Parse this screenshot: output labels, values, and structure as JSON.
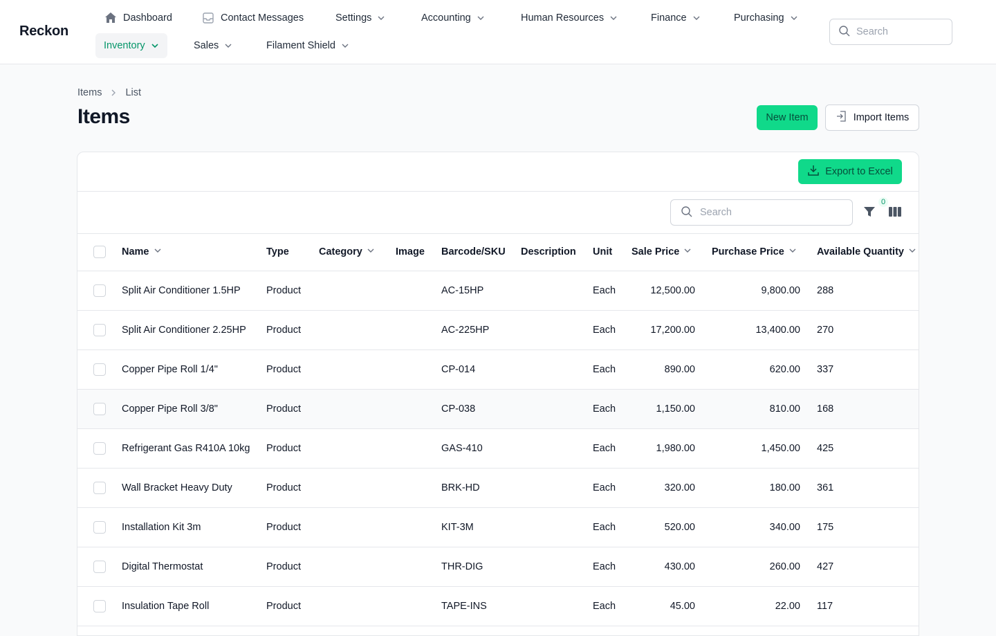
{
  "brand": "Reckon",
  "nav": {
    "row1": [
      {
        "label": "Dashboard",
        "icon": "home-icon",
        "chevron": false
      },
      {
        "label": "Contact Messages",
        "icon": "inbox-icon",
        "chevron": false
      },
      {
        "label": "Settings",
        "chevron": true
      },
      {
        "label": "Accounting",
        "chevron": true
      },
      {
        "label": "Human Resources",
        "chevron": true
      },
      {
        "label": "Finance",
        "chevron": true
      },
      {
        "label": "Purchasing",
        "chevron": true
      }
    ],
    "row2": [
      {
        "label": "Inventory",
        "chevron": true,
        "active": true
      },
      {
        "label": "Sales",
        "chevron": true
      },
      {
        "label": "Filament Shield",
        "chevron": true
      }
    ],
    "search_placeholder": "Search"
  },
  "breadcrumb": [
    "Items",
    "List"
  ],
  "page_title": "Items",
  "actions": {
    "new_item": "New Item",
    "import_items": "Import Items",
    "export": "Export to Excel"
  },
  "table": {
    "search_placeholder": "Search",
    "filter_count": "0",
    "columns": [
      "Name",
      "Type",
      "Category",
      "Image",
      "Barcode/SKU",
      "Description",
      "Unit",
      "Sale Price",
      "Purchase Price",
      "Available Quantity"
    ],
    "rows": [
      {
        "name": "Split Air Conditioner 1.5HP",
        "type": "Product",
        "category": "",
        "sku": "AC-15HP",
        "description": "",
        "unit": "Each",
        "sale": "12,500.00",
        "purchase": "9,800.00",
        "qty": "288"
      },
      {
        "name": "Split Air Conditioner 2.25HP",
        "type": "Product",
        "category": "",
        "sku": "AC-225HP",
        "description": "",
        "unit": "Each",
        "sale": "17,200.00",
        "purchase": "13,400.00",
        "qty": "270"
      },
      {
        "name": "Copper Pipe Roll 1/4\"",
        "type": "Product",
        "category": "",
        "sku": "CP-014",
        "description": "",
        "unit": "Each",
        "sale": "890.00",
        "purchase": "620.00",
        "qty": "337"
      },
      {
        "name": "Copper Pipe Roll 3/8\"",
        "type": "Product",
        "category": "",
        "sku": "CP-038",
        "description": "",
        "unit": "Each",
        "sale": "1,150.00",
        "purchase": "810.00",
        "qty": "168"
      },
      {
        "name": "Refrigerant Gas R410A 10kg",
        "type": "Product",
        "category": "",
        "sku": "GAS-410",
        "description": "",
        "unit": "Each",
        "sale": "1,980.00",
        "purchase": "1,450.00",
        "qty": "425"
      },
      {
        "name": "Wall Bracket Heavy Duty",
        "type": "Product",
        "category": "",
        "sku": "BRK-HD",
        "description": "",
        "unit": "Each",
        "sale": "320.00",
        "purchase": "180.00",
        "qty": "361"
      },
      {
        "name": "Installation Kit 3m",
        "type": "Product",
        "category": "",
        "sku": "KIT-3M",
        "description": "",
        "unit": "Each",
        "sale": "520.00",
        "purchase": "340.00",
        "qty": "175"
      },
      {
        "name": "Digital Thermostat",
        "type": "Product",
        "category": "",
        "sku": "THR-DIG",
        "description": "",
        "unit": "Each",
        "sale": "430.00",
        "purchase": "260.00",
        "qty": "427"
      },
      {
        "name": "Insulation Tape Roll",
        "type": "Product",
        "category": "",
        "sku": "TAPE-INS",
        "description": "",
        "unit": "Each",
        "sale": "45.00",
        "purchase": "22.00",
        "qty": "117"
      }
    ]
  },
  "colors": {
    "accent": "#10d98a",
    "accent_text": "#059669"
  }
}
